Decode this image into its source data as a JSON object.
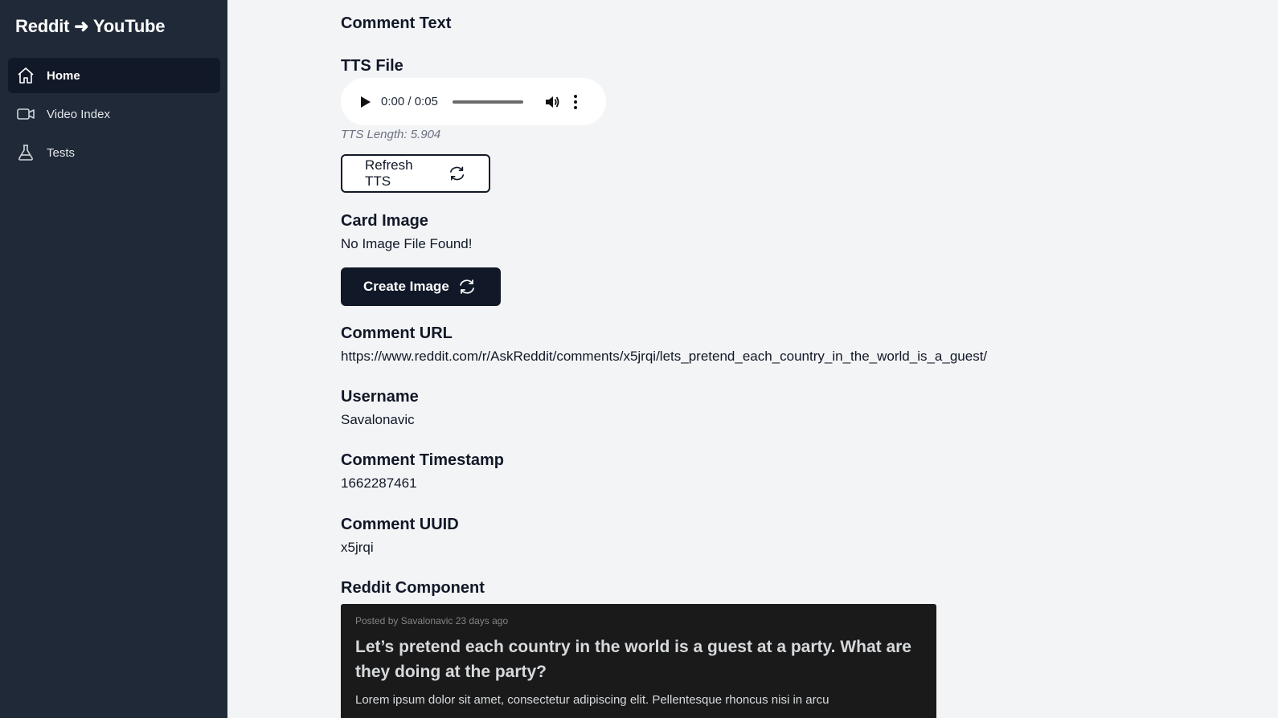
{
  "sidebar": {
    "brand": "Reddit ➜ YouTube",
    "items": [
      {
        "label": "Home",
        "icon": "home-icon",
        "active": true
      },
      {
        "label": "Video Index",
        "icon": "video-camera-icon",
        "active": false
      },
      {
        "label": "Tests",
        "icon": "flask-icon",
        "active": false
      }
    ]
  },
  "main": {
    "comment_text_heading": "Comment Text",
    "tts_heading": "TTS File",
    "audio": {
      "time": "0:00 / 0:05"
    },
    "tts_length": "TTS Length: 5.904",
    "refresh_tts_label": "Refresh TTS",
    "card_image_heading": "Card Image",
    "card_image_value": "No Image File Found!",
    "create_image_label": "Create Image",
    "comment_url_heading": "Comment URL",
    "comment_url_value": "https://www.reddit.com/r/AskReddit/comments/x5jrqi/lets_pretend_each_country_in_the_world_is_a_guest/",
    "username_heading": "Username",
    "username_value": "Savalonavic",
    "timestamp_heading": "Comment Timestamp",
    "timestamp_value": "1662287461",
    "uuid_heading": "Comment UUID",
    "uuid_value": "x5jrqi",
    "reddit_component_heading": "Reddit Component",
    "reddit_card": {
      "meta": "Posted by Savalonavic 23 days ago",
      "title": "Let’s pretend each country in the world is a guest at a party. What are they doing at the party?",
      "body": "Lorem ipsum dolor sit amet, consectetur adipiscing elit. Pellentesque rhoncus nisi in arcu"
    }
  },
  "colors": {
    "sidebar_bg": "#1f2937",
    "nav_active_bg": "#111827",
    "page_bg": "#f3f4f6",
    "dark_button": "#111827",
    "reddit_card_bg": "#1a1a1b"
  }
}
